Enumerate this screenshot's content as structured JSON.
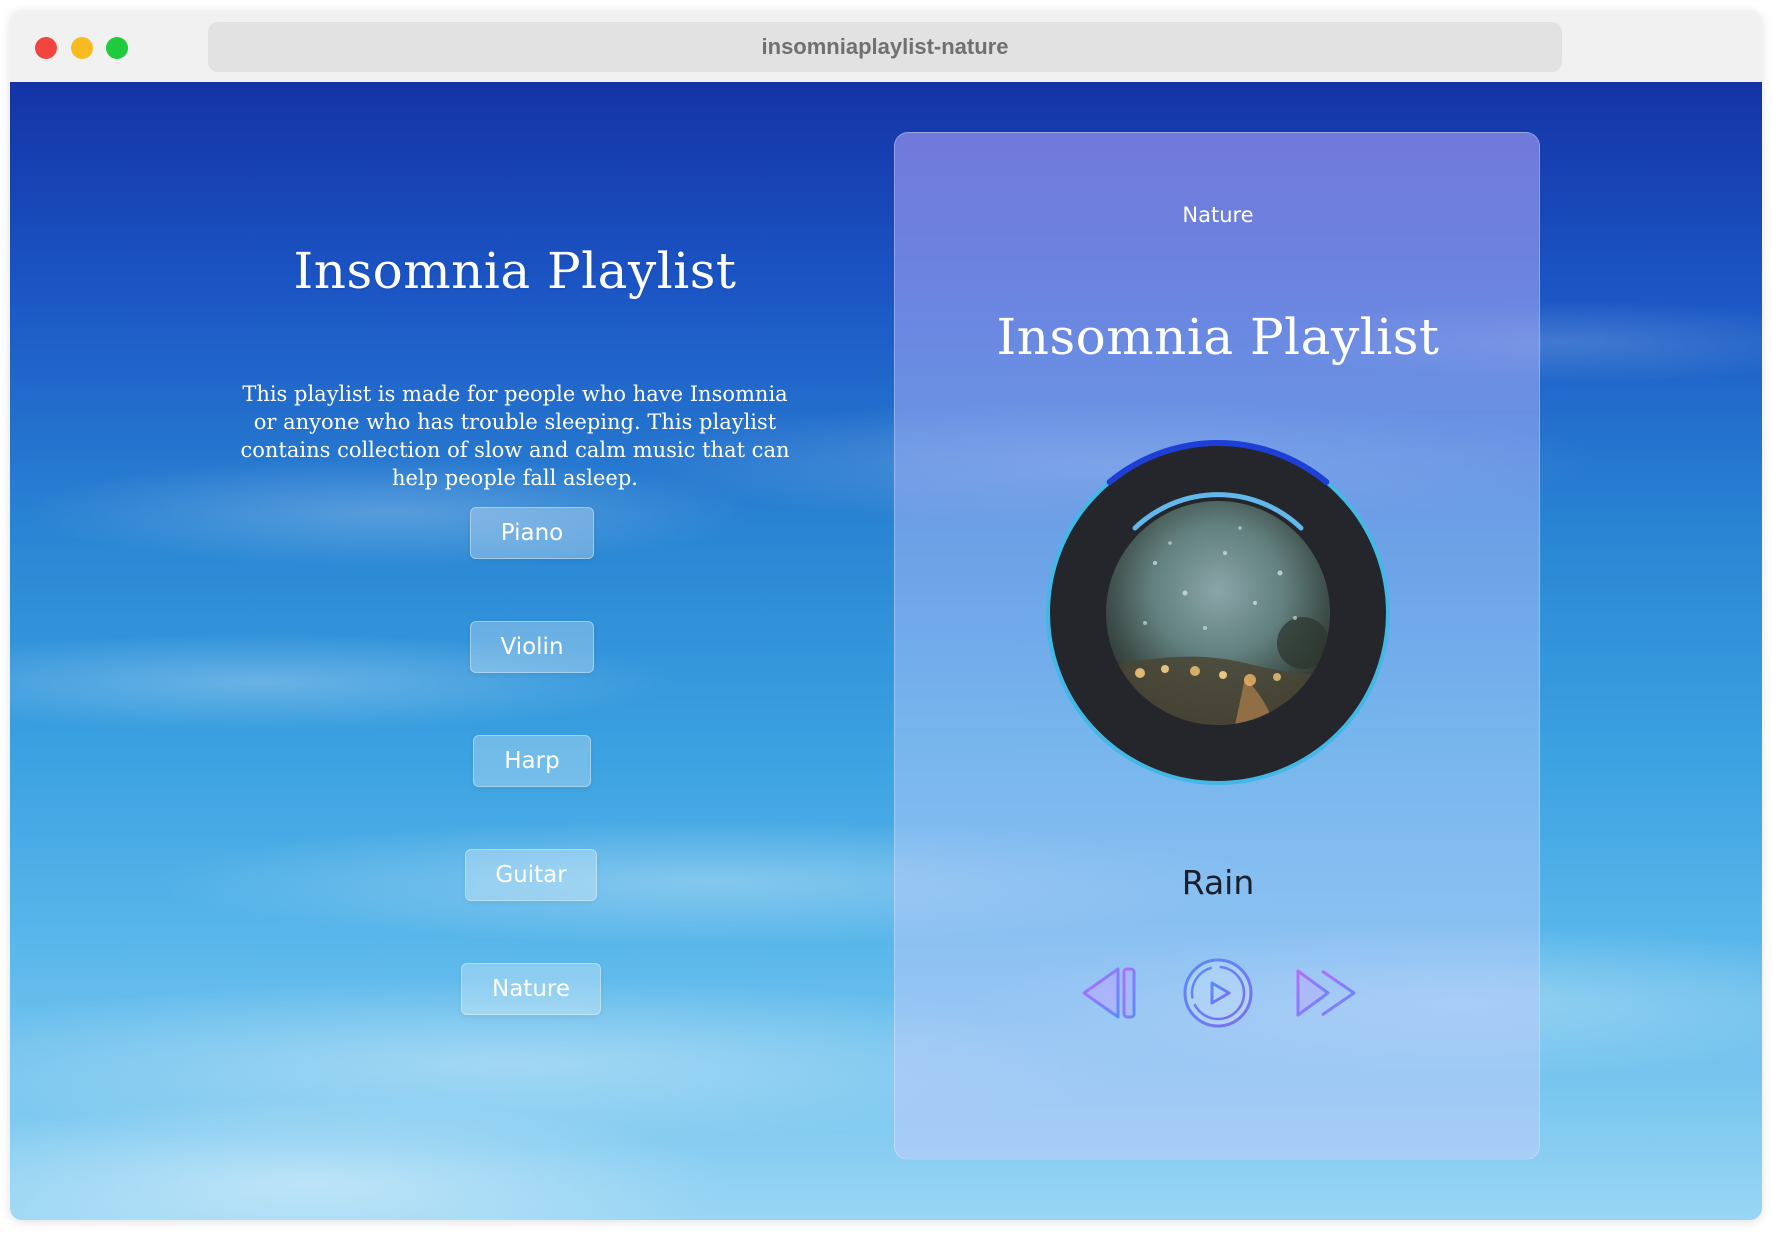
{
  "browser": {
    "url": "insomniaplaylist-nature"
  },
  "left": {
    "title": "Insomnia Playlist",
    "description": "This playlist is made for people who have Insomnia or anyone who has trouble sleeping. This playlist contains collection of slow and calm music that can help people fall asleep.",
    "playlists": [
      {
        "label": "Piano"
      },
      {
        "label": "Violin"
      },
      {
        "label": "Harp"
      },
      {
        "label": "Guitar"
      },
      {
        "label": "Nature"
      }
    ]
  },
  "player": {
    "category": "Nature",
    "title": "Insomnia Playlist",
    "track": "Rain",
    "progress": 0.22,
    "controls": {
      "prev_icon": "skip-back-icon",
      "play_icon": "play-icon",
      "next_icon": "fast-forward-icon"
    },
    "colors": {
      "accent": "#1e3fd6",
      "ring": "#43b7e5",
      "disc": "#24262c",
      "icon_gradient_start": "#b56cff",
      "icon_gradient_end": "#5a8cf5"
    }
  }
}
